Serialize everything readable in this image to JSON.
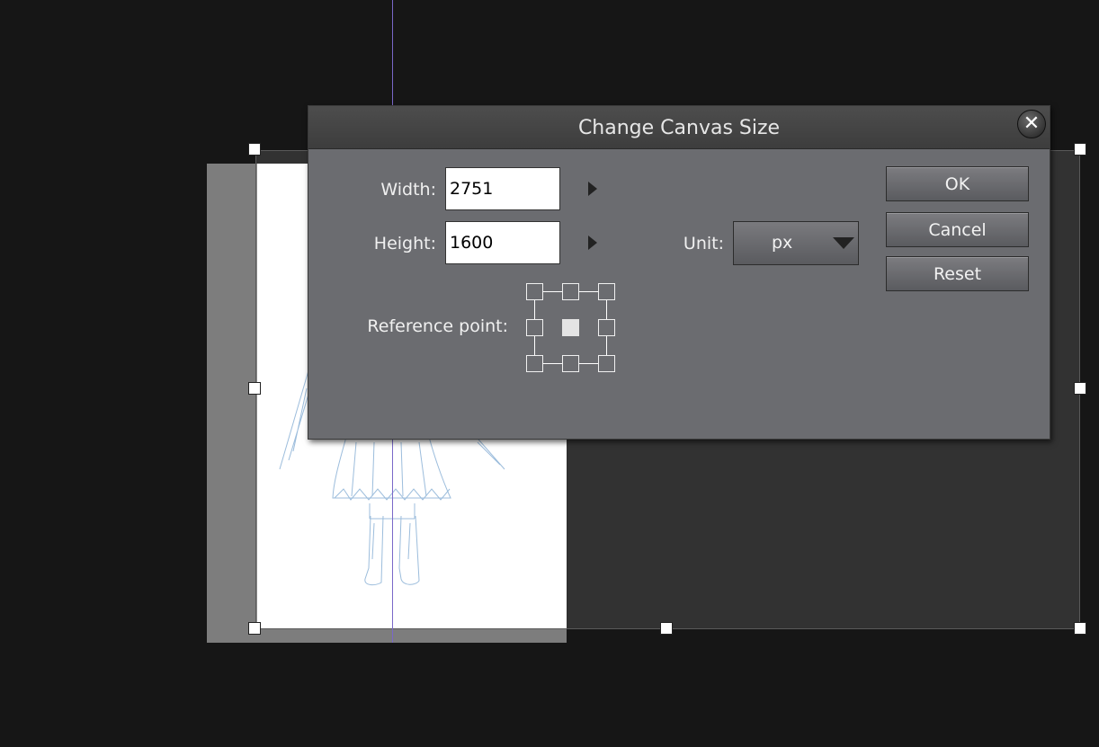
{
  "dialog": {
    "title": "Change Canvas Size",
    "close_icon": "close-icon"
  },
  "fields": {
    "width_label": "Width:",
    "width_value": "2751",
    "height_label": "Height:",
    "height_value": "1600",
    "reference_label": "Reference point:",
    "unit_label": "Unit:",
    "unit_value": "px"
  },
  "buttons": {
    "ok": "OK",
    "cancel": "Cancel",
    "reset": "Reset"
  },
  "reference_point": {
    "selected": "center",
    "positions": [
      "top-left",
      "top-center",
      "top-right",
      "middle-left",
      "center",
      "middle-right",
      "bottom-left",
      "bottom-center",
      "bottom-right"
    ]
  },
  "colors": {
    "dialog_bg": "#6b6c70",
    "titlebar": "#444444",
    "workspace": "#161616"
  }
}
